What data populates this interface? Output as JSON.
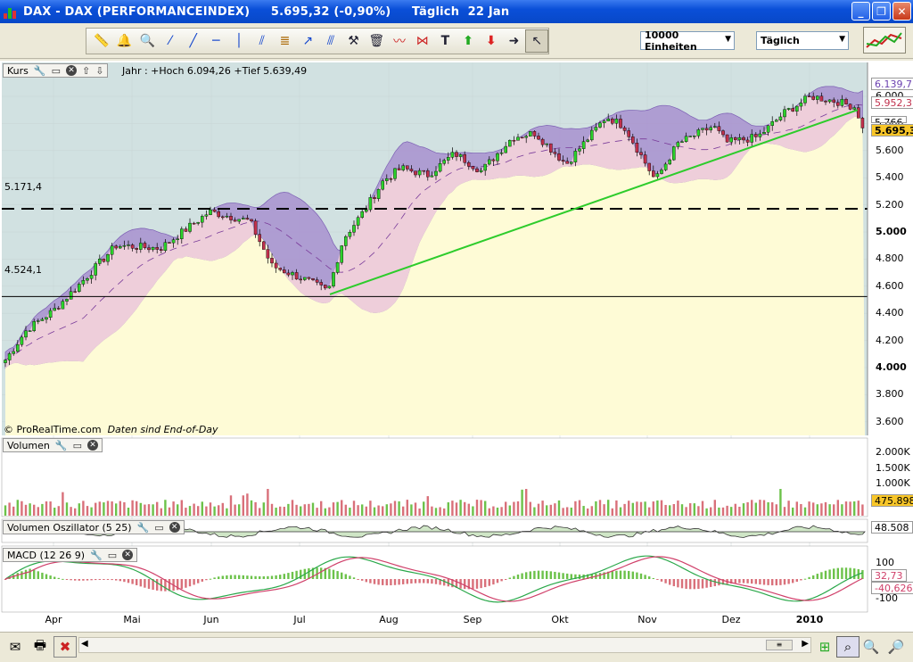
{
  "window": {
    "title": "DAX - DAX (PERFORMANCEINDEX)     5.695,32 (-0,90%)     Täglich  22 Jan",
    "min_icon": "minimize-icon",
    "max_icon": "maximize-icon",
    "close_icon": "close-icon"
  },
  "toolbar": {
    "units_value": "10000 Einheiten",
    "period_value": "Täglich",
    "tools": [
      "ruler-icon",
      "alarm-bell-icon",
      "zoom-icon",
      "line-icon",
      "trendline-icon",
      "horizontal-line-icon",
      "vertical-line-icon",
      "channel-icon",
      "fibonacci-icon",
      "arrow-line-icon",
      "parallel-icon",
      "hammer-icon",
      "trash-icon",
      "wave-icon",
      "triangle-icon",
      "text-icon",
      "up-arrow-icon",
      "down-arrow-icon",
      "right-arrow-icon",
      "cursor-icon"
    ]
  },
  "price_panel": {
    "label": "Kurs",
    "info": "Jahr : +Hoch 6.094,26 +Tief 5.639,49",
    "copyright": "© ProRealTime.com",
    "note": "Daten sind End-of-Day",
    "level_upper": "5.171,4",
    "level_lower": "4.524,1",
    "axis_ticks": [
      "6.000",
      "5.800",
      "5.600",
      "5.400",
      "5.200",
      "5.000",
      "4.800",
      "4.600",
      "4.400",
      "4.200",
      "4.000",
      "3.800",
      "3.600"
    ],
    "boxes": [
      "6.139,7",
      "5.952,3",
      "5.766",
      "5.695,32"
    ],
    "colors": {
      "bg_top": "#d1e1e1",
      "bg_fill": "#fefbd6",
      "band": "#a891cf",
      "band_inner": "#eeceda",
      "trend": "#2dcc2b",
      "up": "#2bd22b",
      "down": "#c0304c"
    }
  },
  "volume_panel": {
    "label": "Volumen",
    "axis_ticks": [
      "2.000K",
      "1.500K",
      "1.000K",
      "500K"
    ],
    "value": "475.898"
  },
  "oscillator_panel": {
    "label": "Volumen Oszillator (5 25)",
    "value": "48.508"
  },
  "macd_panel": {
    "label": "MACD (12 26 9)",
    "axis_ticks": [
      "100",
      "-100"
    ],
    "values": [
      "32,73",
      "-40,626"
    ]
  },
  "months": [
    "Apr",
    "Mai",
    "Jun",
    "Jul",
    "Aug",
    "Sep",
    "Okt",
    "Nov",
    "Dez",
    "2010"
  ],
  "chart_data": {
    "type": "candlestick",
    "title": "DAX - DAX (PERFORMANCEINDEX)",
    "period": "Täglich",
    "last": 5695.32,
    "change_pct": -0.9,
    "y_range": [
      3500,
      6250
    ],
    "levels": [
      5171.4,
      4524.1
    ],
    "monthly_close": [
      {
        "month": "Apr",
        "close": 4750
      },
      {
        "month": "Mai",
        "close": 4940
      },
      {
        "month": "Jun",
        "close": 4810
      },
      {
        "month": "Jul",
        "close": 5330
      },
      {
        "month": "Aug",
        "close": 5460
      },
      {
        "month": "Sep",
        "close": 5680
      },
      {
        "month": "Okt",
        "close": 5410
      },
      {
        "month": "Nov",
        "close": 5620
      },
      {
        "month": "Dez",
        "close": 5960
      },
      {
        "month": "2010",
        "close": 5695
      }
    ]
  }
}
